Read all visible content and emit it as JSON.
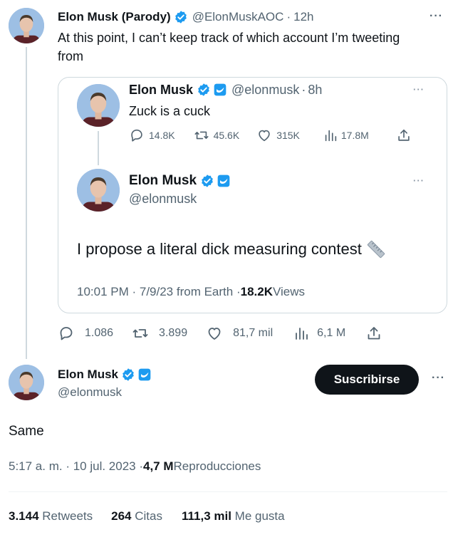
{
  "colors": {
    "verified_blue": "#1d9bf0",
    "text": "#0f1419",
    "secondary": "#536471",
    "border": "#cfd9de",
    "avatar_bg": "#9dbfe4"
  },
  "top_tweet": {
    "name": "Elon Musk (Parody)",
    "handle": "@ElonMuskAOC",
    "sep": "·",
    "time": "12h",
    "text": "At this point, I can’t keep track of which account I’m tweeting from",
    "icons": [
      "verified-badge-icon",
      "more-icon"
    ],
    "stats": {
      "replies": "1.086",
      "retweets": "3.899",
      "likes": "81,7 mil",
      "views": "6,1 M"
    }
  },
  "quote": {
    "reply": {
      "name": "Elon Musk",
      "handle": "@elonmusk",
      "sep": "·",
      "time": "8h",
      "text": "Zuck is a cuck",
      "stats": {
        "replies": "14.8K",
        "retweets": "45.6K",
        "likes": "315K",
        "views": "17.8M"
      }
    },
    "main": {
      "name": "Elon Musk",
      "handle": "@elonmusk",
      "text": "I propose a literal dick measuring contest",
      "emoji_icon": "ruler-icon",
      "time_date": "10:01 PM · 7/9/23 from Earth · ",
      "views_count": "18.2K",
      "views_label": " Views"
    }
  },
  "main_tweet": {
    "name": "Elon Musk",
    "handle": "@elonmusk",
    "subscribe_label": "Suscribirse",
    "text": "Same",
    "timestamp": "5:17 a. m. · 10 jul. 2023 · ",
    "views_count": "4,7 M",
    "views_label": " Reproducciones",
    "engagement": {
      "retweets_count": "3.144",
      "retweets_label": " Retweets",
      "quotes_count": "264",
      "quotes_label": " Citas",
      "likes_count": "111,3 mil",
      "likes_label": " Me gusta"
    }
  }
}
